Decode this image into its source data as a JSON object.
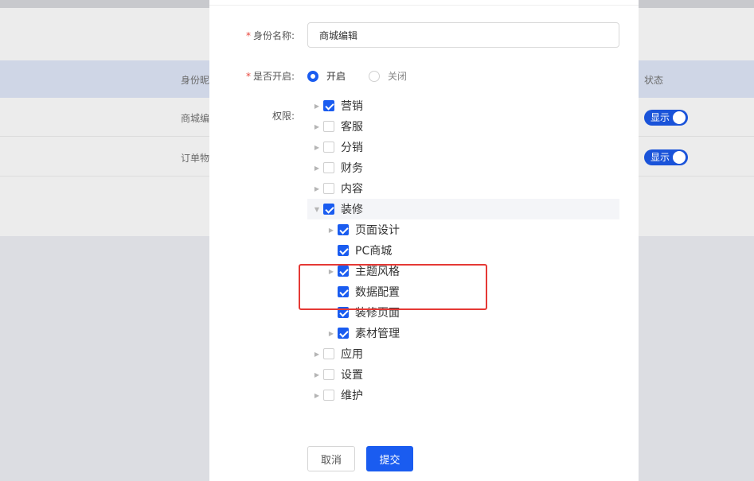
{
  "background_table": {
    "header_name": "身份昵",
    "header_status": "状态",
    "rows": [
      {
        "name": "商城编",
        "status": "显示"
      },
      {
        "name": "订单物",
        "status": "显示"
      }
    ]
  },
  "form": {
    "name_label": "身份名称:",
    "name_value": "商城编辑",
    "enable_label": "是否开启:",
    "enable_options": [
      "开启",
      "关闭"
    ],
    "enable_selected": "开启",
    "permissions_label": "权限:",
    "required_mark": "*"
  },
  "tree": {
    "items": [
      {
        "label": "营销",
        "checked": true,
        "expanded": false
      },
      {
        "label": "客服",
        "checked": false,
        "expanded": false
      },
      {
        "label": "分销",
        "checked": false,
        "expanded": false
      },
      {
        "label": "财务",
        "checked": false,
        "expanded": false
      },
      {
        "label": "内容",
        "checked": false,
        "expanded": false
      },
      {
        "label": "装修",
        "checked": true,
        "expanded": true,
        "children": [
          {
            "label": "页面设计",
            "checked": true
          },
          {
            "label": "PC商城",
            "checked": true
          },
          {
            "label": "主题风格",
            "checked": true
          },
          {
            "label": "数据配置",
            "checked": true
          },
          {
            "label": "装修页面",
            "checked": true
          },
          {
            "label": "素材管理",
            "checked": true
          }
        ]
      },
      {
        "label": "应用",
        "checked": false,
        "expanded": false
      },
      {
        "label": "设置",
        "checked": false,
        "expanded": false
      },
      {
        "label": "维护",
        "checked": false,
        "expanded": false
      }
    ]
  },
  "buttons": {
    "cancel": "取消",
    "submit": "提交"
  },
  "colors": {
    "primary": "#1a5cf0",
    "highlight_box": "#e53935"
  }
}
